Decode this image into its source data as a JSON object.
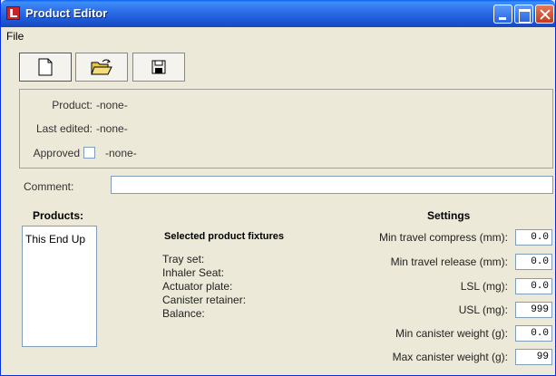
{
  "window": {
    "title": "Product Editor"
  },
  "menu": {
    "items": [
      {
        "label": "File"
      }
    ]
  },
  "toolbar": {
    "buttons": [
      {
        "icon": "new-document-icon"
      },
      {
        "icon": "open-folder-icon"
      },
      {
        "icon": "save-disk-icon"
      }
    ]
  },
  "info": {
    "product_label": "Product:",
    "product_value": "-none-",
    "last_edited_label": "Last edited:",
    "last_edited_value": "-none-",
    "approved_label": "Approved",
    "approved_checked": false,
    "approved_value": "-none-"
  },
  "comment": {
    "label": "Comment:",
    "value": ""
  },
  "products": {
    "heading": "Products:",
    "items": [
      "This End Up"
    ]
  },
  "fixtures": {
    "heading": "Selected product fixtures",
    "items": [
      "Tray set:",
      "Inhaler Seat:",
      "Actuator plate:",
      "Canister retainer:",
      "Balance:"
    ]
  },
  "settings": {
    "heading": "Settings",
    "fields": [
      {
        "label": "Min travel compress (mm):",
        "value": "0.0"
      },
      {
        "label": "Min travel release (mm):",
        "value": "0.0"
      },
      {
        "label": "LSL (mg):",
        "value": "0.0"
      },
      {
        "label": "USL (mg):",
        "value": "999"
      },
      {
        "label": "Min canister weight (g):",
        "value": "0.0"
      },
      {
        "label": "Max canister weight (g):",
        "value": "99"
      }
    ]
  },
  "colors": {
    "titlebar": "#2f6fe8",
    "window_bg": "#ece9d8",
    "input_border": "#7f9db9"
  }
}
